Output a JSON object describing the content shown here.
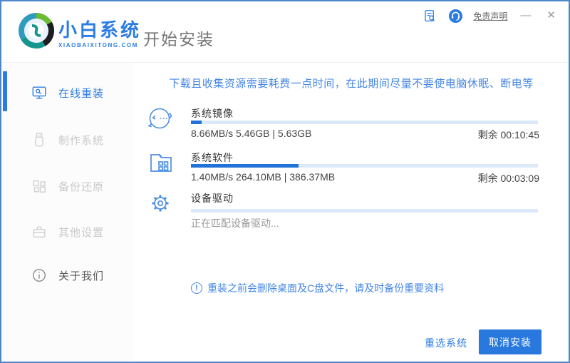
{
  "header": {
    "logo_title": "小白系统",
    "logo_subtitle": "XIAOBAIXITONG.COM",
    "page_title": "开始安装",
    "disclaimer_link": "免责声明",
    "minimize_glyph": "—",
    "close_glyph": "✕"
  },
  "sidebar": {
    "items": [
      {
        "label": "在线重装",
        "active": true,
        "state": "active"
      },
      {
        "label": "制作系统",
        "active": false,
        "state": "disabled"
      },
      {
        "label": "备份还原",
        "active": false,
        "state": "disabled"
      },
      {
        "label": "其他设置",
        "active": false,
        "state": "disabled"
      },
      {
        "label": "关于我们",
        "active": false,
        "state": "normal"
      }
    ]
  },
  "main": {
    "warning": "下载且收集资源需要耗费一点时间，在此期间尽量不要使电脑休眠、断电等",
    "tasks": [
      {
        "title": "系统镜像",
        "stats": "8.66MB/s 5.46GB | 5.63GB",
        "remaining": "剩余 00:10:45",
        "progress_pct": 3
      },
      {
        "title": "系统软件",
        "stats": "1.40MB/s 264.10MB | 386.37MB",
        "remaining": "剩余 00:03:09",
        "progress_pct": 31
      },
      {
        "title": "设备驱动",
        "status": "正在匹配设备驱动...",
        "progress_pct": 0
      }
    ],
    "note_icon_glyph": "!",
    "note": "重装之前会删除桌面及C盘文件，请及时备份重要资料"
  },
  "footer": {
    "reselect_label": "重选系统",
    "cancel_label": "取消安装"
  },
  "colors": {
    "primary_blue": "#2b7ce2",
    "bar_fill": "#2273d8",
    "bar_track": "#dce9f8",
    "warning_blue": "#4486e4",
    "border_blue": "#4d87c7"
  }
}
